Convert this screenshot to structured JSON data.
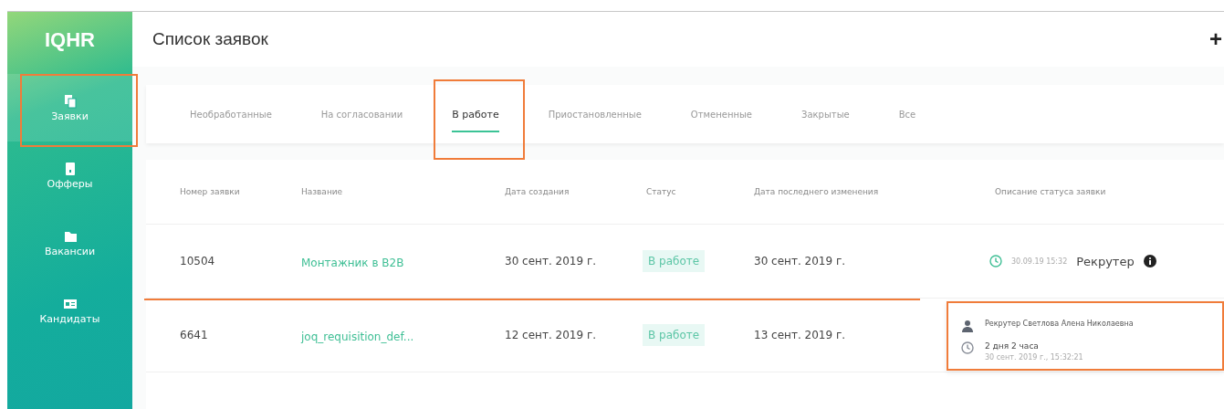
{
  "sidebar": {
    "logo": "IQHR",
    "items": [
      {
        "label": "Заявки",
        "selected": true,
        "highlighted": true
      },
      {
        "label": "Офферы",
        "selected": false,
        "highlighted": false
      },
      {
        "label": "Вакансии",
        "selected": false,
        "highlighted": false
      },
      {
        "label": "Кандидаты",
        "selected": false,
        "highlighted": false
      }
    ]
  },
  "page": {
    "title": "Список заявок",
    "add_button": "+"
  },
  "tabs": [
    {
      "label": "Необработанные",
      "selected": false,
      "highlighted": false
    },
    {
      "label": "На согласовании",
      "selected": false,
      "highlighted": false
    },
    {
      "label": "В работе",
      "selected": true,
      "highlighted": true
    },
    {
      "label": "Приостановленные",
      "selected": false,
      "highlighted": false
    },
    {
      "label": "Отмененные",
      "selected": false,
      "highlighted": false
    },
    {
      "label": "Закрытые",
      "selected": false,
      "highlighted": false
    },
    {
      "label": "Все",
      "selected": false,
      "highlighted": false
    }
  ],
  "table": {
    "columns": [
      "Номер заявки",
      "Название",
      "Дата создания",
      "Статус",
      "Дата последнего изменения",
      "Описание статуса заявки"
    ],
    "rows": [
      {
        "number": "10504",
        "name": "Монтажник в B2B",
        "created": "30 сент. 2019 г.",
        "status": "В работе",
        "modified": "30 сент. 2019 г.",
        "status_time": "30.09.19 15:32",
        "status_role": "Рекрутер",
        "highlighted": true
      },
      {
        "number": "6641",
        "name": "joq_requisition_def...",
        "created": "12 сент. 2019 г.",
        "status": "В работе",
        "modified": "13 сент. 2019 г.",
        "highlighted": false
      }
    ]
  },
  "tooltip": {
    "person": "Рекрутер Светлова Алена Николаевна",
    "duration": "2 дня 2 часа",
    "timestamp": "30 сент. 2019 г., 15:32:21",
    "highlighted": true
  }
}
